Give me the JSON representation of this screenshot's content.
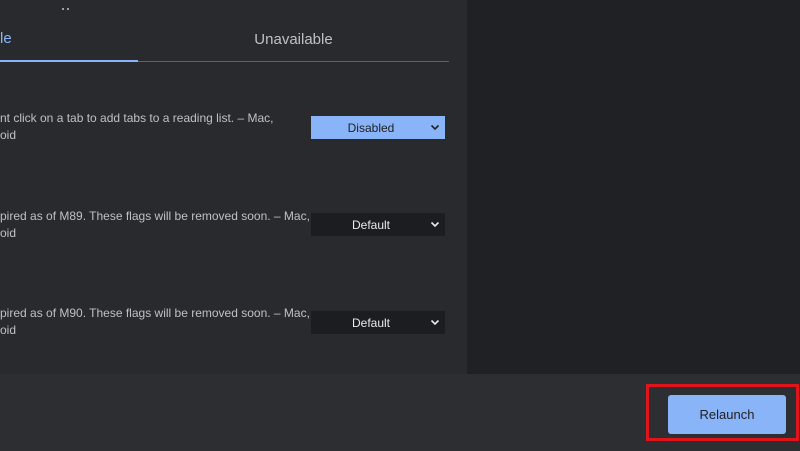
{
  "tabs": {
    "available_label": "le",
    "unavailable_label": "Unavailable"
  },
  "flags": [
    {
      "description_line1": "nt click on a tab to add tabs to a reading list. – Mac,",
      "description_line2": "oid",
      "selected_value": "Disabled"
    },
    {
      "description_line1": "pired as of M89. These flags will be removed soon. – Mac,",
      "description_line2": "oid",
      "selected_value": "Default"
    },
    {
      "description_line1": "pired as of M90. These flags will be removed soon. – Mac,",
      "description_line2": "oid",
      "selected_value": "Default"
    }
  ],
  "footer": {
    "relaunch_label": "Relaunch"
  },
  "colors": {
    "accent": "#8ab4f8",
    "highlight": "#e0141b",
    "background": "#292a2d"
  },
  "icons": {
    "select_arrow": "chevron-down-icon"
  }
}
